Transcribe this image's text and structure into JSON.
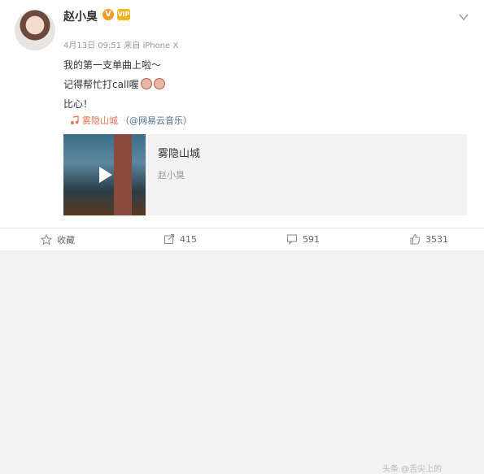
{
  "post": {
    "username": "赵小臭",
    "verified_badge": "V",
    "vip_badge": "VIP",
    "meta": "4月13日 09:51 来自 iPhone X",
    "lines": [
      "我的第一支单曲上啦～",
      "记得帮忙打call喔",
      "比心！"
    ],
    "link_text": "雾隐山城",
    "link_source": "（@网易云音乐）",
    "music": {
      "title": "雾隐山城",
      "artist": "赵小臭"
    }
  },
  "actions": {
    "favorite_label": "收藏",
    "share_count": "415",
    "comment_count": "591",
    "like_count": "3531"
  },
  "watermark": "头条 @舌尖上的"
}
